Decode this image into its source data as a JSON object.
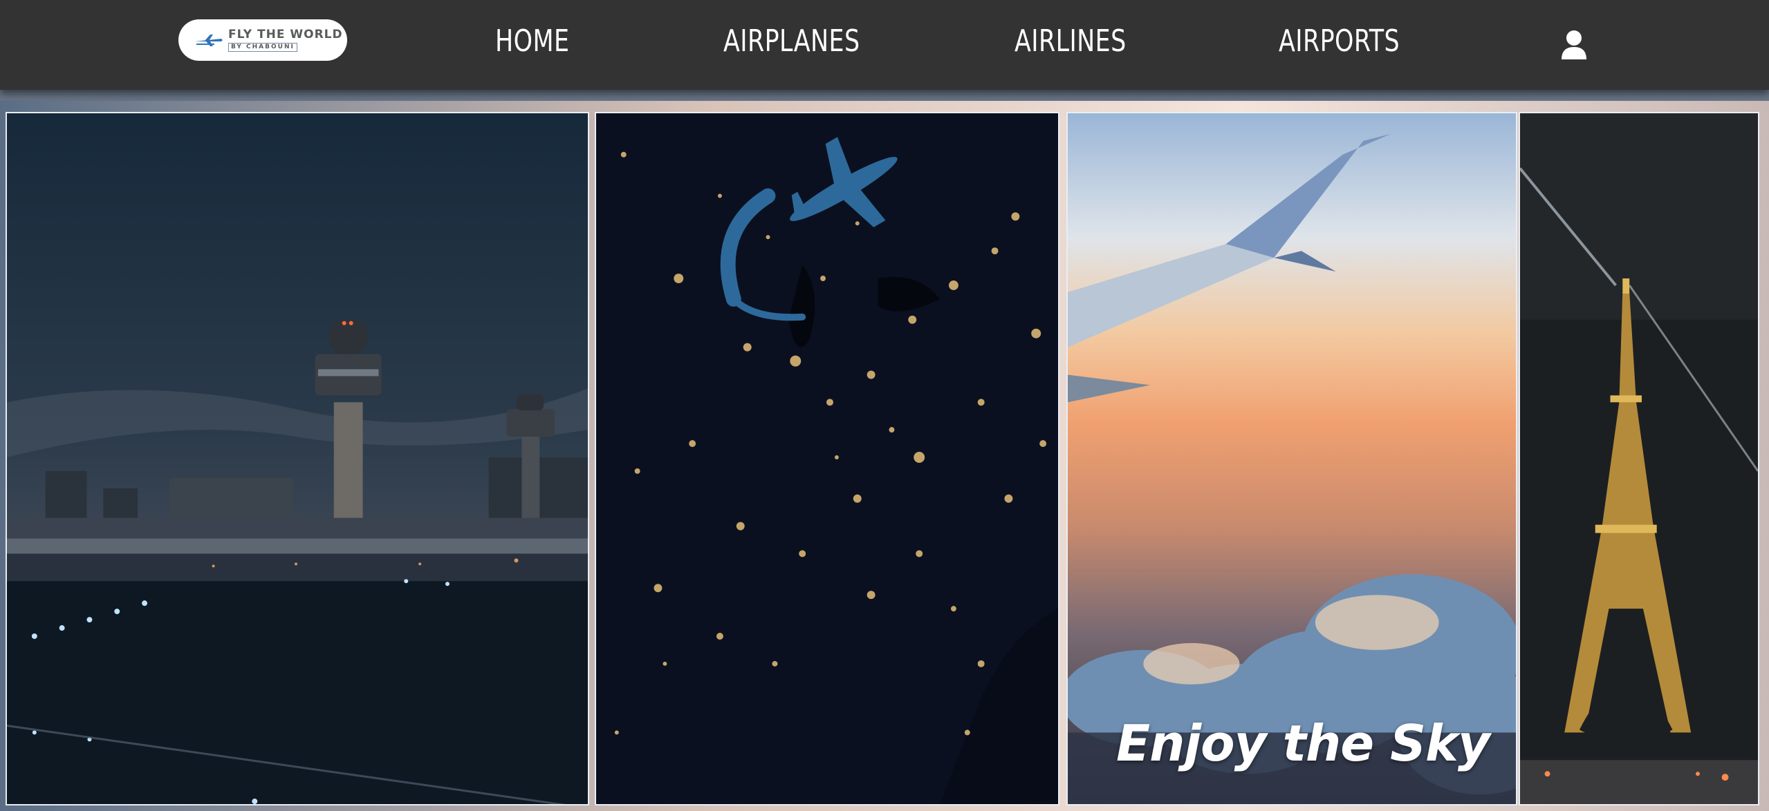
{
  "brand": {
    "logo_line1": "FLY THE WORLD",
    "logo_line2": "BY CHABOUNI"
  },
  "nav": {
    "items": [
      {
        "label": "HOME"
      },
      {
        "label": "AIRPLANES"
      },
      {
        "label": "AIRLINES"
      },
      {
        "label": "AIRPORTS"
      }
    ],
    "user_icon": "user-icon"
  },
  "hero": {
    "caption": "Enjoy the Sky",
    "panels": [
      {
        "subject": "airport control tower at night"
      },
      {
        "subject": "night map of city lights with airplane"
      },
      {
        "subject": "airplane wing above clouds at sunset"
      },
      {
        "subject": "eiffel tower at night"
      }
    ]
  },
  "colors": {
    "navbar": "#333333",
    "nav_text": "#ffffff",
    "logo_bg": "#ffffff",
    "accent_blue": "#2d6a9b"
  }
}
